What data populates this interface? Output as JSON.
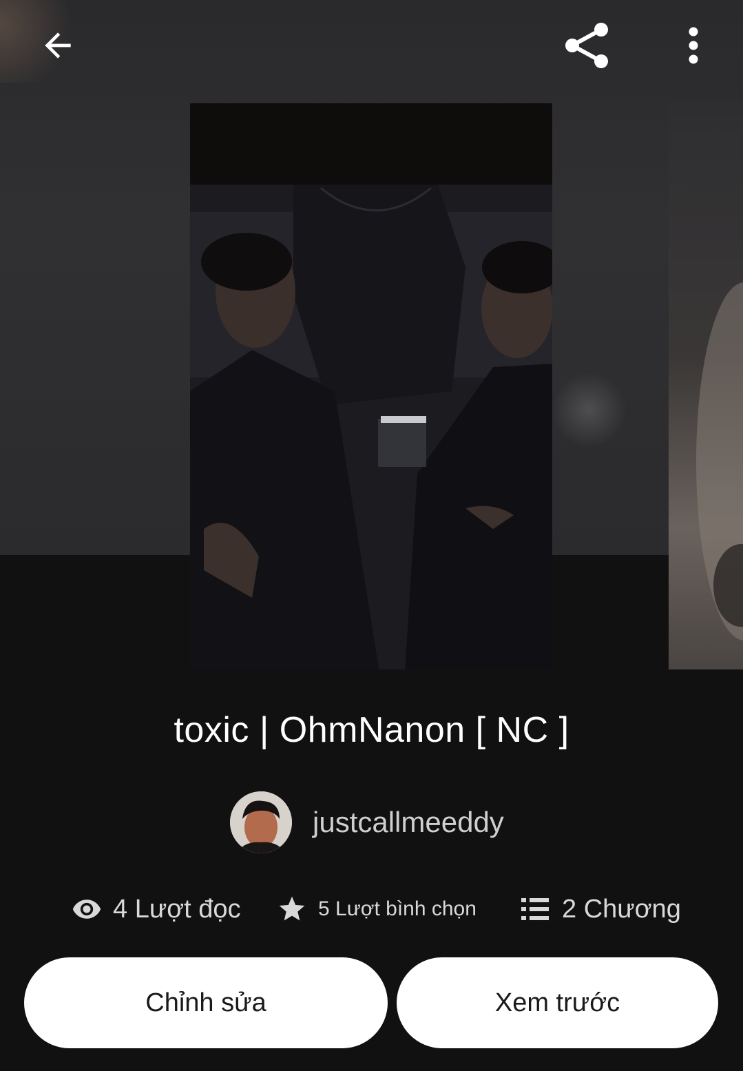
{
  "header": {
    "icons": [
      "back-arrow-icon",
      "share-icon",
      "more-vertical-icon"
    ]
  },
  "story": {
    "title": "toxic | OhmNanon [ NC ]",
    "author": "justcallmeeddy"
  },
  "stats": {
    "reads": "4 Lượt đọc",
    "votes": "5 Lượt bình chọn",
    "parts": "2 Chương"
  },
  "actions": {
    "edit": "Chỉnh sửa",
    "preview": "Xem trước"
  },
  "colors": {
    "background": "#121111",
    "button_bg": "#ffffff",
    "button_text": "#1a1a1a",
    "stat_text": "#d9d9d9"
  }
}
